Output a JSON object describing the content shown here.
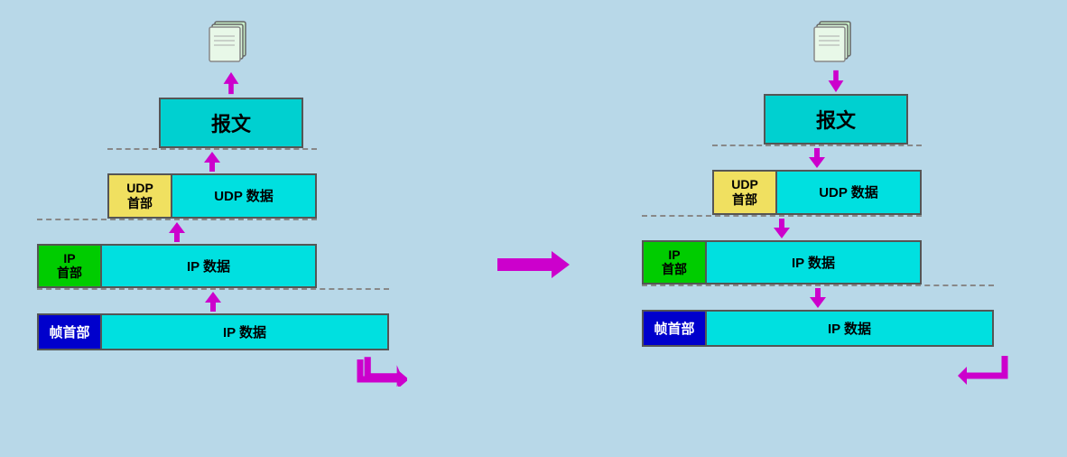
{
  "background_color": "#b8d8e8",
  "left_diagram": {
    "doc_icon": "document-stack",
    "layers": [
      {
        "label": "报文",
        "type": "baowenbox"
      },
      {
        "left": "UDP\n首部",
        "right": "UDP 数据",
        "type": "udp"
      },
      {
        "left": "IP\n首部",
        "right": "IP 数据",
        "type": "ip"
      },
      {
        "left": "帧首部",
        "right": "IP 数据",
        "type": "frame"
      }
    ]
  },
  "right_diagram": {
    "doc_icon": "document-stack",
    "layers": [
      {
        "label": "报文",
        "type": "baowenbox"
      },
      {
        "left": "UDP\n首部",
        "right": "UDP 数据",
        "type": "udp"
      },
      {
        "left": "IP\n首部",
        "right": "IP 数据",
        "type": "ip"
      },
      {
        "left": "帧首部",
        "right": "IP 数据",
        "type": "frame"
      }
    ]
  },
  "labels": {
    "baowen": "报文",
    "udp_header": "UDP\n首部",
    "udp_data": "UDP 数据",
    "ip_header": "IP\n首部",
    "ip_data": "IP 数据",
    "frame_header": "帧首部"
  },
  "arrow_color": "#cc00cc",
  "center_arrow_label": ""
}
